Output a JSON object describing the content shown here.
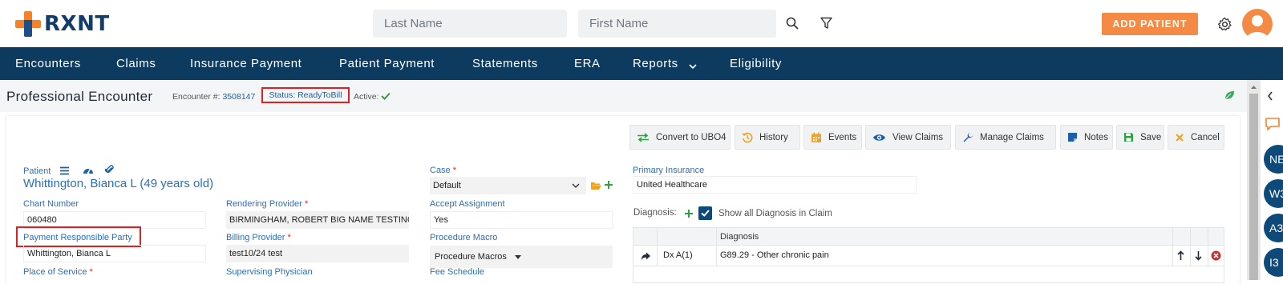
{
  "brand": {
    "name": "RXNT",
    "orange": "#f5822a",
    "navy": "#0d3b60"
  },
  "header": {
    "last_name_placeholder": "Last Name",
    "first_name_placeholder": "First Name",
    "add_patient_label": "ADD PATIENT"
  },
  "nav": {
    "items": [
      {
        "label": "Encounters"
      },
      {
        "label": "Claims"
      },
      {
        "label": "Insurance Payment"
      },
      {
        "label": "Patient Payment"
      },
      {
        "label": "Statements"
      },
      {
        "label": "ERA"
      },
      {
        "label": "Reports"
      },
      {
        "label": "Eligibility"
      }
    ]
  },
  "titlebar": {
    "title": "Professional Encounter",
    "encounter_label": "Encounter #:",
    "encounter_number": "3508147",
    "status_label": "Status:",
    "status_value": "ReadyToBill",
    "active_label": "Active:"
  },
  "side_buttons": [
    "NE",
    "W3",
    "A3",
    "I3"
  ],
  "toolbar": {
    "convert": "Convert to UBO4",
    "history": "History",
    "events": "Events",
    "view_claims": "View Claims",
    "manage_claims": "Manage Claims",
    "notes": "Notes",
    "save": "Save",
    "cancel": "Cancel"
  },
  "patient": {
    "label": "Patient",
    "name": "Whittington, Bianca L (49 years old)",
    "chart_number_label": "Chart Number",
    "chart_number": "060480",
    "payment_party_label": "Payment Responsible Party",
    "payment_party": "Whittington, Bianca L",
    "place_of_service_label": "Place of Service"
  },
  "providers": {
    "rendering_label": "Rendering Provider",
    "rendering_value": "BIRMINGHAM, ROBERT BIG NAME TESTING C",
    "billing_label": "Billing Provider",
    "billing_value": "test10/24 test",
    "supervising_label": "Supervising Physician"
  },
  "case": {
    "label": "Case",
    "value": "Default",
    "accept_assignment_label": "Accept Assignment",
    "accept_assignment_value": "Yes",
    "procedure_macro_label": "Procedure Macro",
    "procedure_macro_value": "Procedure Macros",
    "fee_schedule_label": "Fee Schedule"
  },
  "insurance": {
    "primary_label": "Primary Insurance",
    "primary_value": "United Healthcare"
  },
  "diagnosis": {
    "label": "Diagnosis:",
    "show_all_label": "Show all Diagnosis in Claim",
    "show_all_checked": true,
    "column_header": "Diagnosis",
    "rows": [
      {
        "pointer": "Dx A(1)",
        "description": "G89.29 - Other chronic pain"
      }
    ]
  }
}
